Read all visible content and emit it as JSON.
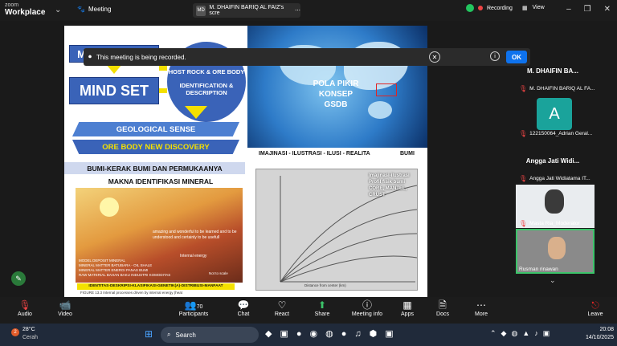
{
  "app": {
    "brand_top": "zoom",
    "brand_bottom": "Workplace",
    "meeting_label": "Meeting",
    "share_tab_initials": "MD",
    "share_tab_title": "M. DHAIFIN BARIQ AL FAIZ's scre",
    "recording_label": "Recording",
    "view_label": "View"
  },
  "notice": {
    "text": "This meeting is being recorded.",
    "ok_label": "OK"
  },
  "slide": {
    "master_mind": "MASTER MIND",
    "mind_set": "MIND SET",
    "host_rock": "HOST ROCK & ORE BODY",
    "identification": "IDENTIFICATION & DESCRIPTION",
    "geological_sense": "GEOLOGICAL SENSE",
    "ore_body": "ORE BODY NEW DISCOVERY",
    "bumi_kerak": "BUMI-KERAK BUMI DAN PERMUKAANYA",
    "makna": "MAKNA IDENTIFIKASI MINERAL",
    "pola_pikir": "POLA PIKIR",
    "konsep": "KONSEP",
    "gsdb": "GSDB",
    "imajinasi_row": "IMAJINASI - ILUSTRASI - ILUSI - REALITA",
    "bumi": "BUMI",
    "amazing": "amazing and wonderful to be learned and to be understood and certainly to be usefull",
    "internal_energy": "Internal energy",
    "model_text": "MODEL DEPOSIT MINERAL\nMINERAL MATTER BATUBARA - OIL SHALE\nMINERAL MATTER ENERGI PANAS BUMI\nRAW MATERIAL BAHAN BAKU INDUSTRI KOMODITAS",
    "identitas": "IDENTITAS-DESKRIPSI-KLASIFIKASI-GENETIK(A)-DISTRIBUSI-MANFAAT",
    "figure_caption": "FIGURE 13.3 Internal processes driven by internal energy (heat",
    "not_to_scale": "Not to scale",
    "imajinasi_caption": "Imajinasi-ilustrasi Profil fisik bumi CORE, MANTEL, CRUST",
    "distance_label": "Distance from center (km)"
  },
  "participants": [
    {
      "name_header": "M. DHAIFIN BA...",
      "label": "M. DHAIFIN BARIQ AL FA..."
    },
    {
      "avatar_letter": "A",
      "label": "122150064_Adrian Geral..."
    },
    {
      "name_header": "Angga Jati Widi...",
      "label": "Angga Jati Widiatama IT..."
    },
    {
      "label": "Masta Ria_Moderator"
    },
    {
      "label": "Rusman rinawan"
    }
  ],
  "toolbar": {
    "audio": "Audio",
    "video": "Video",
    "participants": "Participants",
    "participants_count": "70",
    "chat": "Chat",
    "react": "React",
    "share": "Share",
    "meeting_info": "Meeting info",
    "apps": "Apps",
    "docs": "Docs",
    "more": "More",
    "leave": "Leave"
  },
  "taskbar": {
    "temp": "28°C",
    "weather": "Cerah",
    "search": "Search",
    "notif_count": "2",
    "time": "20:08",
    "date": "14/10/2025"
  },
  "colors": {
    "blue_box": "#3a63b8",
    "yellow": "#f4e000",
    "ok_blue": "#0e72ed",
    "leave_red": "#e02424"
  }
}
